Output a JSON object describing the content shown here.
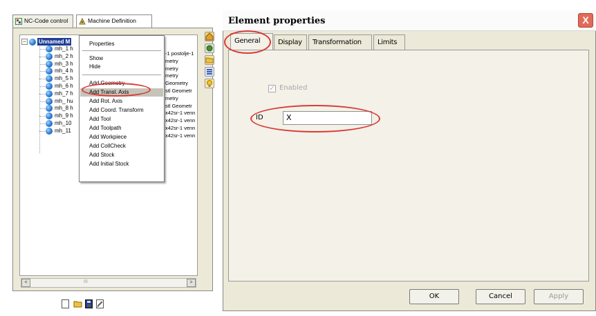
{
  "left_window": {
    "tabs": [
      {
        "label": "NC-Code control",
        "icon": "nc-code-icon"
      },
      {
        "label": "Machine Definition",
        "icon": "machine-definition-icon"
      }
    ],
    "tree": {
      "root": "Unnamed M",
      "items": [
        "mh_1 h",
        "mh_2 h",
        "mh_3 h",
        "mh_4 h",
        "mh_5 h",
        "mh_6 h",
        "mh_7 h",
        "mh_ hu",
        "mh_8 h",
        "mh_9 h",
        "mh_10",
        "mh_11"
      ],
      "right_fragments": [
        "-1 postolje-1",
        "metry",
        "metry",
        "metry",
        "Geometry",
        "stl Geometr",
        "metry",
        "stl Geometr",
        "x42sr-1 venn",
        "x42sr-1 venn",
        "x42sr-1 venn",
        "x42sr-1 venn"
      ]
    },
    "context_menu": {
      "items": [
        "Properties",
        "Show",
        "Hide",
        "Add Geometry",
        "Add Transl. Axis",
        "Add Rot. Axis",
        "Add Coord. Transform",
        "Add Tool",
        "Add Toolpath",
        "Add Workpiece",
        "Add CollCheck",
        "Add Stock",
        "Add Initial Stock"
      ],
      "highlighted": "Add Transl. Axis"
    },
    "scrollbar": {
      "thumb_label": "III",
      "left_arrow": "<",
      "right_arrow": ">"
    }
  },
  "dialog": {
    "title": "Element properties",
    "close_label": "X",
    "tabs": [
      "General",
      "Display",
      "Transformation",
      "Limits"
    ],
    "active_tab": "General",
    "enabled": {
      "label": "Enabled",
      "checked": true,
      "disabled": true
    },
    "id": {
      "label": "ID",
      "value": "X"
    },
    "buttons": {
      "ok": "OK",
      "cancel": "Cancel",
      "apply": "Apply"
    }
  },
  "colors": {
    "annotation_red": "#d93a34",
    "dialog_bg": "#ece9d8",
    "close_red": "#e26a5a"
  }
}
